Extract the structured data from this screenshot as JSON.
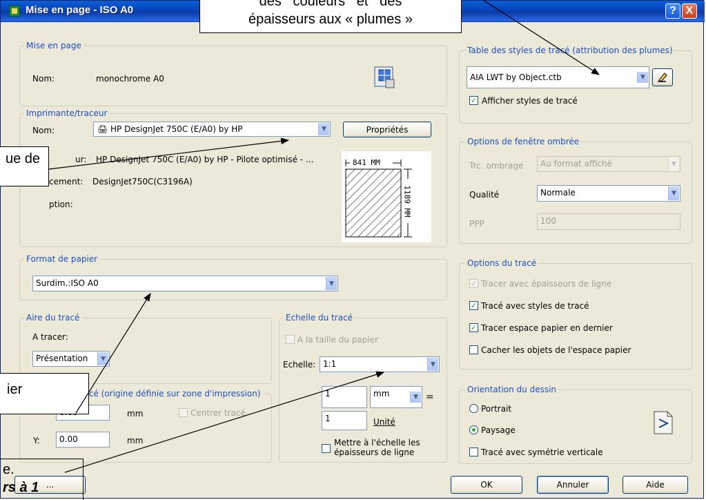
{
  "window": {
    "title": "Mise en page - ISO A0",
    "help": "?",
    "close": "X"
  },
  "page_setup": {
    "legend": "Mise en page",
    "name_label": "Nom:",
    "name_value": "monochrome A0"
  },
  "printer": {
    "legend": "Imprimante/traceur",
    "name_label": "Nom:",
    "selected": "HP DesignJet 750C (E/A0) by HP",
    "properties_button": "Propriétés",
    "plotter_label": "ur:",
    "plotter_value": "HP DesignJet 750C (E/A0) by HP - Pilote optimisé - ...",
    "location_label": "cement:",
    "location_value": "DesignJet750C(C3196A)",
    "description_label": "ption:",
    "preview_width": "841 MM",
    "preview_height": "1189 MM"
  },
  "paper": {
    "legend": "Format de papier",
    "selected": "Surdim.:ISO A0"
  },
  "plot_area": {
    "legend": "Aire du tracé",
    "what_label": "A tracer:",
    "what_selected": "Présentation"
  },
  "plot_offset": {
    "legend": "ge du tracé (origine définie sur zone d'impression)",
    "x_value": "0.00",
    "x_unit": "mm",
    "center_label": "Centrer tracé",
    "y_label": "Y:",
    "y_value": "0.00",
    "y_unit": "mm"
  },
  "plot_scale": {
    "legend": "Echelle du tracé",
    "fit_label": "A la taille du papier",
    "scale_label": "Echelle:",
    "scale_selected": "1:1",
    "mm_value": "1",
    "mm_unit": "mm",
    "equals": "=",
    "unit_value": "1",
    "unit_label": "Unité",
    "lineweights_label_1": "Mettre à l'échelle les",
    "lineweights_label_2": "épaisseurs de ligne"
  },
  "style_table": {
    "legend": "Table des styles de tracé (attribution des plumes)",
    "selected": "AIA LWT by Object.ctb",
    "show_styles": "Afficher styles de tracé"
  },
  "shaded": {
    "legend": "Options de fenêtre ombrée",
    "shade_label": "Trc. ombrage",
    "shade_value": "Au format affiché",
    "quality_label": "Qualité",
    "quality_value": "Normale",
    "dpi_label": "PPP",
    "dpi_value": "100"
  },
  "plot_options": {
    "legend": "Options du tracé",
    "items": [
      {
        "label": "Tracer avec épaisseurs de ligne",
        "checked": true,
        "enabled": false
      },
      {
        "label": "Tracé avec styles de tracé",
        "checked": true,
        "enabled": true
      },
      {
        "label": "Tracer espace papier en dernier",
        "checked": true,
        "enabled": true
      },
      {
        "label": "Cacher les objets de l'espace papier",
        "checked": false,
        "enabled": true
      }
    ]
  },
  "orientation": {
    "legend": "Orientation du dessin",
    "portrait": "Portrait",
    "landscape": "Paysage",
    "mirror": "Tracé avec symétrie verticale",
    "selected": "Paysage"
  },
  "buttons": {
    "preview": "...",
    "ok": "OK",
    "cancel": "Annuler",
    "help": "Aide"
  },
  "callouts": {
    "top_line1": "des   couleurs   et   des",
    "top_line2": "épaisseurs aux « plumes »",
    "left_printer": "ue  de",
    "left_paper": "ier",
    "bottom_line1": "e.",
    "bottom_line2": "rs à 1"
  }
}
